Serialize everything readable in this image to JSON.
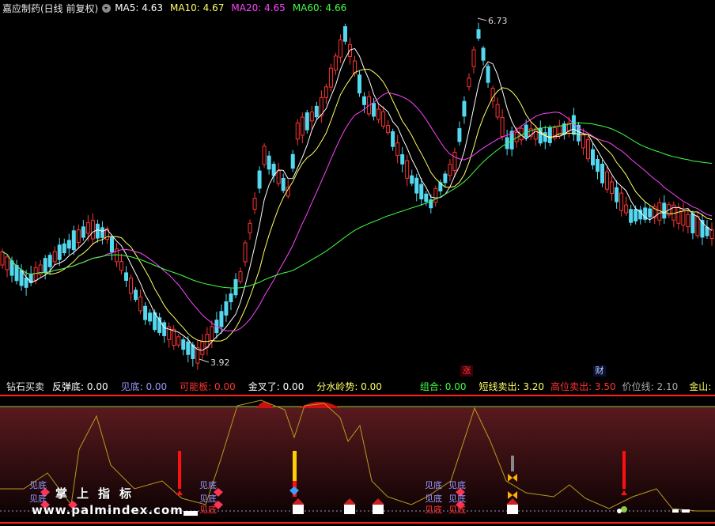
{
  "header": {
    "title": "嘉应制药(日线 前复权)",
    "ma": [
      {
        "label": "MA5: 4.63",
        "color": "#ffffff"
      },
      {
        "label": "MA10: 4.67",
        "color": "#ffff66"
      },
      {
        "label": "MA20: 4.65",
        "color": "#ff44ff"
      },
      {
        "label": "MA60: 4.66",
        "color": "#44ff44"
      }
    ]
  },
  "chart": {
    "high_label": "6.73",
    "low_label": "3.92",
    "colors": {
      "up": "#ff3333",
      "down": "#54d8f0",
      "ma5": "#ffffff",
      "ma10": "#ffff66",
      "ma20": "#ff44ff",
      "ma60": "#44ff44"
    }
  },
  "badges": {
    "zhang": "涨",
    "cai": "财"
  },
  "indicator": {
    "name": "钻石买卖",
    "items": [
      {
        "label": "反弹底: 0.00",
        "color": "#ffffff"
      },
      {
        "label": "见底: 0.00",
        "color": "#9999ff"
      },
      {
        "label": "可能板: 0.00",
        "color": "#ff3333"
      },
      {
        "label": "金叉了: 0.00",
        "color": "#ffffff"
      },
      {
        "label": "分水岭势: 0.00",
        "color": "#ffff66"
      },
      {
        "label": "组合: 0.00",
        "color": "#44ff44"
      },
      {
        "label": "短线卖出: 3.20",
        "color": "#ffff66"
      },
      {
        "label": "高位卖出: 3.50",
        "color": "#ff3333"
      },
      {
        "label": "价位线: 2.10",
        "color": "#aaaaaa"
      },
      {
        "label": "金山:",
        "color": "#ffff66"
      }
    ],
    "marker_text": "见底"
  },
  "watermark": {
    "line1": "掌上指标",
    "line2": "www.palmindex.com"
  }
}
